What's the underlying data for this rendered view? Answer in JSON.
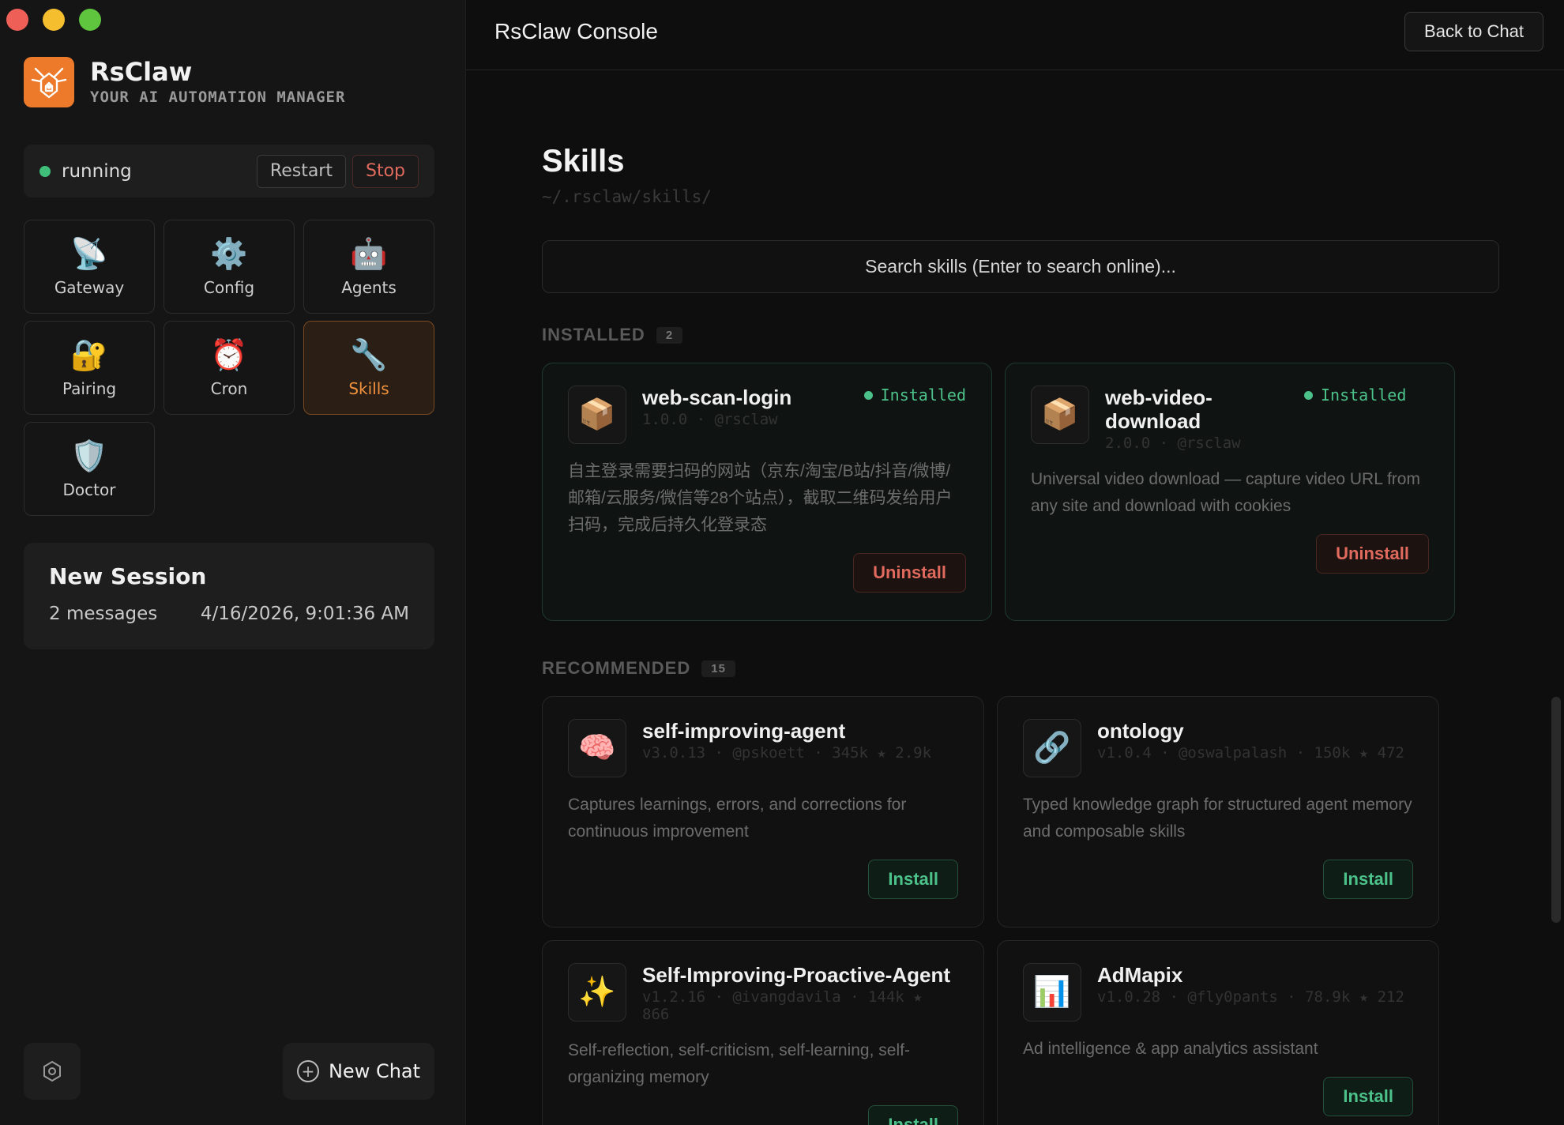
{
  "window": {
    "controls": [
      "close",
      "minimize",
      "maximize"
    ]
  },
  "sidebar": {
    "brand": {
      "name": "RsClaw",
      "subtitle": "YOUR AI AUTOMATION MANAGER",
      "logo_icon": "claw-logo-icon"
    },
    "status": {
      "text": "running",
      "color": "#3fbf7a",
      "restart_label": "Restart",
      "stop_label": "Stop"
    },
    "tiles": [
      {
        "label": "Gateway",
        "icon": "📡",
        "icon_name": "satellite-dish-icon",
        "active": false
      },
      {
        "label": "Config",
        "icon": "⚙️",
        "icon_name": "gear-icon",
        "active": false
      },
      {
        "label": "Agents",
        "icon": "🤖",
        "icon_name": "robot-icon",
        "active": false
      },
      {
        "label": "Pairing",
        "icon": "🔐",
        "icon_name": "lock-key-icon",
        "active": false
      },
      {
        "label": "Cron",
        "icon": "⏰",
        "icon_name": "alarm-clock-icon",
        "active": false
      },
      {
        "label": "Skills",
        "icon": "🔧",
        "icon_name": "wrench-icon",
        "active": true
      },
      {
        "label": "Doctor",
        "icon": "🛡️",
        "icon_name": "shield-icon",
        "active": false
      }
    ],
    "session": {
      "title": "New Session",
      "messages": "2 messages",
      "timestamp": "4/16/2026, 9:01:36 AM"
    },
    "new_chat_label": "New Chat",
    "accent": "#f0913e"
  },
  "header": {
    "title": "RsClaw Console",
    "back_label": "Back to Chat"
  },
  "main": {
    "title": "Skills",
    "path": "~/.rsclaw/skills/",
    "search_placeholder": "Search skills (Enter to search online)...",
    "installed": {
      "label": "INSTALLED",
      "count": "2",
      "items": [
        {
          "name": "web-scan-login",
          "meta": "1.0.0 · @rsclaw",
          "badge": "Installed",
          "icon": "📦",
          "icon_name": "package-icon",
          "desc": "自主登录需要扫码的网站（京东/淘宝/B站/抖音/微博/邮箱/云服务/微信等28个站点），截取二维码发给用户扫码，完成后持久化登录态",
          "action": "Uninstall"
        },
        {
          "name": "web-video-download",
          "meta": "2.0.0 · @rsclaw",
          "badge": "Installed",
          "icon": "📦",
          "icon_name": "package-icon",
          "desc": "Universal video download — capture video URL from any site and download with cookies",
          "action": "Uninstall"
        }
      ]
    },
    "recommended": {
      "label": "RECOMMENDED",
      "count": "15",
      "items": [
        {
          "name": "self-improving-agent",
          "meta": "v3.0.13 · @pskoett · 345k ★ 2.9k",
          "icon": "🧠",
          "icon_name": "brain-icon",
          "desc": "Captures learnings, errors, and corrections for continuous improvement",
          "action": "Install"
        },
        {
          "name": "ontology",
          "meta": "v1.0.4 · @oswalpalash · 150k ★ 472",
          "icon": "🔗",
          "icon_name": "link-icon",
          "desc": "Typed knowledge graph for structured agent memory and composable skills",
          "action": "Install"
        },
        {
          "name": "Self-Improving-Proactive-Agent",
          "meta": "v1.2.16 · @ivangdavila · 144k ★ 866",
          "icon": "✨",
          "icon_name": "sparkles-icon",
          "desc": "Self-reflection, self-criticism, self-learning, self-organizing memory",
          "action": "Install"
        },
        {
          "name": "AdMapix",
          "meta": "v1.0.28 · @fly0pants · 78.9k ★ 212",
          "icon": "📊",
          "icon_name": "bar-chart-icon",
          "desc": "Ad intelligence & app analytics assistant",
          "action": "Install"
        }
      ]
    }
  }
}
